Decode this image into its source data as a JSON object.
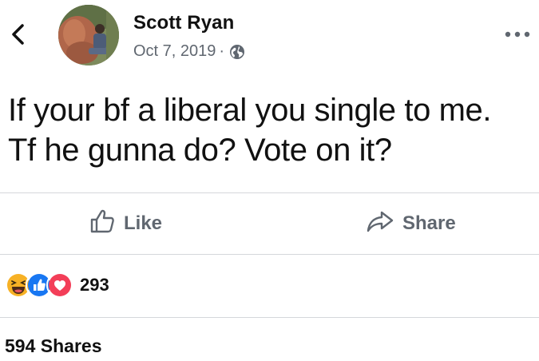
{
  "post": {
    "author": "Scott Ryan",
    "date": "Oct 7, 2019",
    "separator": "·",
    "privacy_icon": "globe-icon",
    "text": "If your bf a liberal you single to me.\nTf he gunna do? Vote on it?"
  },
  "actions": {
    "like_label": "Like",
    "share_label": "Share"
  },
  "stats": {
    "reaction_icons": [
      "haha-icon",
      "like-reaction-icon",
      "love-icon"
    ],
    "reaction_count": "293",
    "shares": "594 Shares"
  },
  "colors": {
    "text": "#111111",
    "muted": "#606770",
    "divider": "#d5d7db",
    "like_blue": "#1877f2",
    "love_red": "#f33e58",
    "haha_yellow": "#f7b125"
  }
}
